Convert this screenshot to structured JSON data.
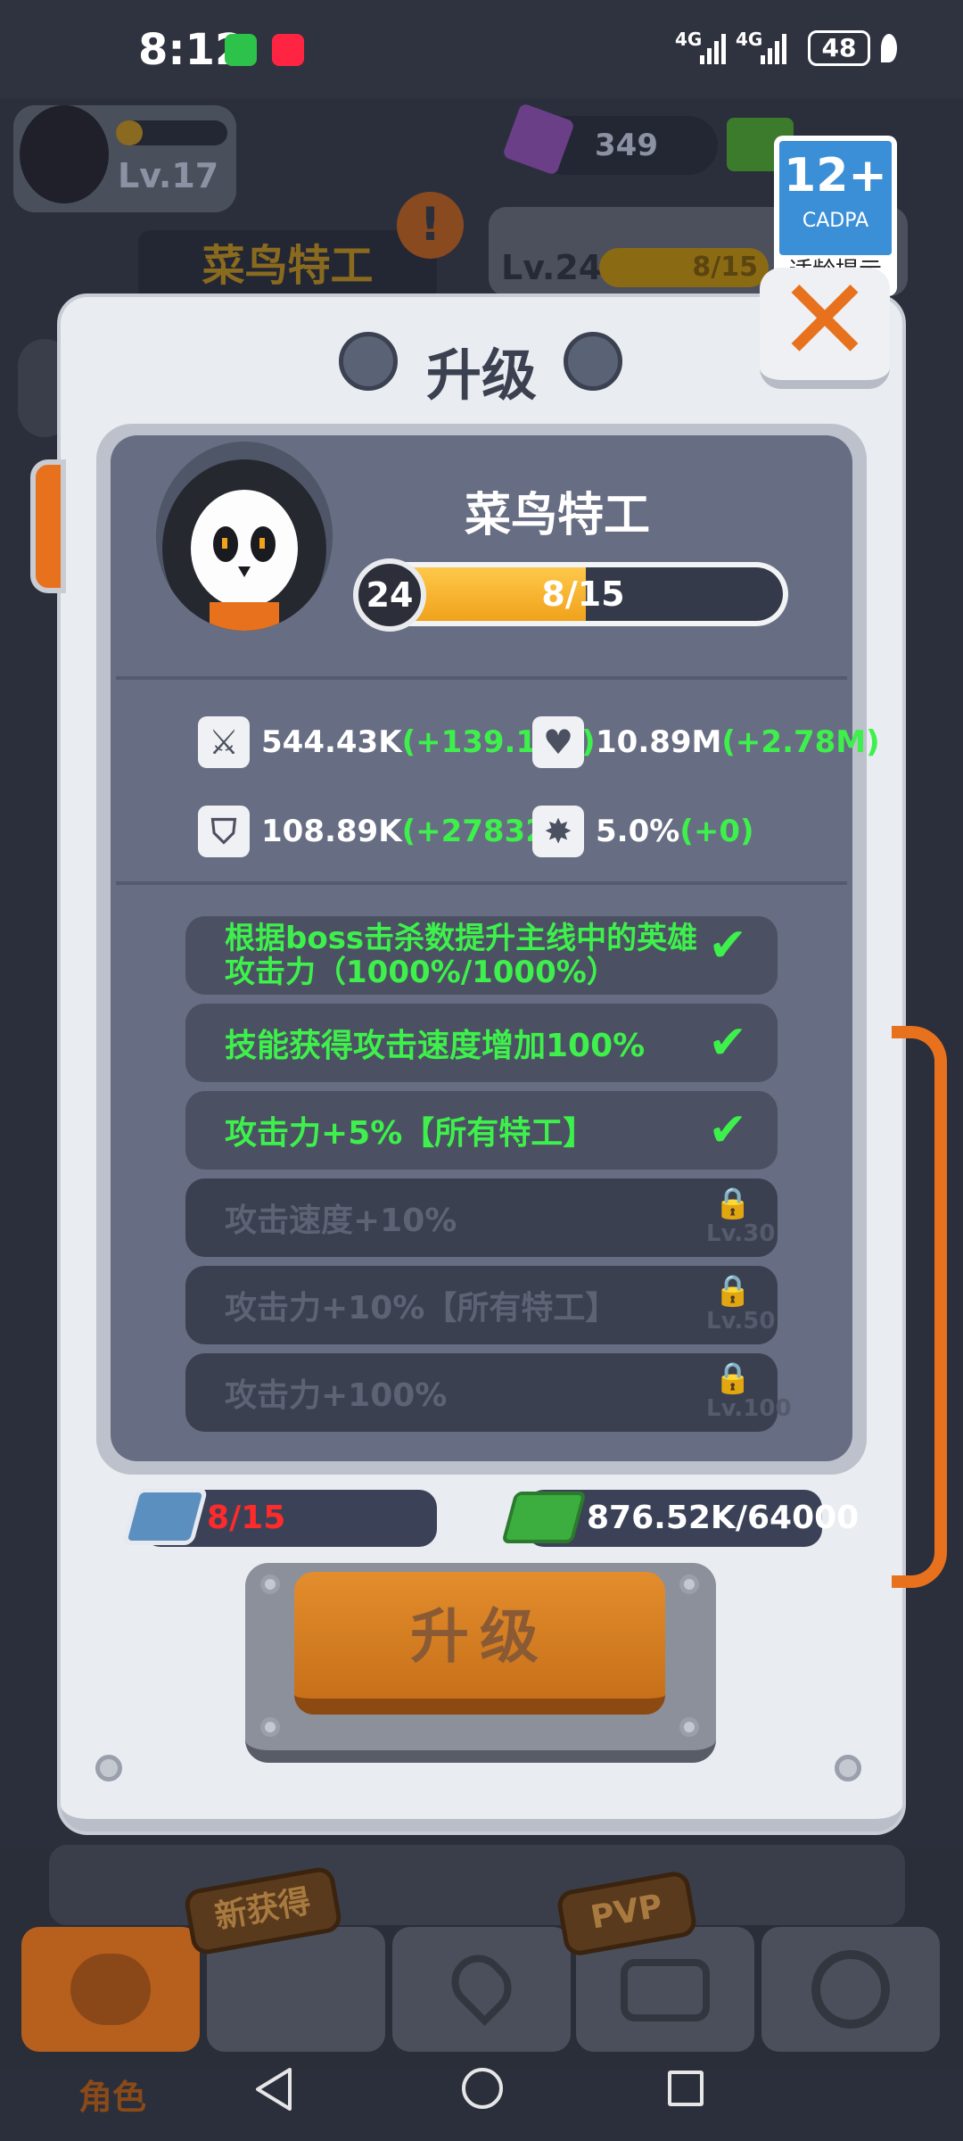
{
  "status_bar": {
    "time": "8:12",
    "net1": "4G",
    "net2": "4G",
    "battery": "48"
  },
  "top": {
    "player_level": "Lv.17",
    "gems": "349",
    "agent_name": "菜鸟特工",
    "agent_level": "Lv.24",
    "agent_progress": "8/15",
    "warning_icon": "exclamation-icon"
  },
  "cadpa": {
    "age": "12+",
    "org": "CADPA",
    "tip": "适龄提示"
  },
  "modal": {
    "title": "升级",
    "hero_name": "菜鸟特工",
    "level": "24",
    "progress_text": "8/15",
    "progress_fraction": 0.533,
    "stats": [
      {
        "icon": "sword-icon",
        "value": "544.43K",
        "bonus": "(+139.16K)"
      },
      {
        "icon": "heart-icon",
        "value": "10.89M",
        "bonus": "(+2.78M)"
      },
      {
        "icon": "shield-icon",
        "value": "108.89K",
        "bonus": "(+27832)"
      },
      {
        "icon": "crit-icon",
        "value": "5.0%",
        "bonus": "(+0)"
      }
    ],
    "perks": [
      {
        "text": "根据boss击杀数提升主线中的英雄攻击力（1000%/1000%）",
        "unlocked": true,
        "lock_level": ""
      },
      {
        "text": "技能获得攻击速度增加100%",
        "unlocked": true,
        "lock_level": ""
      },
      {
        "text": "攻击力+5%【所有特工】",
        "unlocked": true,
        "lock_level": ""
      },
      {
        "text": "攻击速度+10%",
        "unlocked": false,
        "lock_level": "Lv.30"
      },
      {
        "text": "攻击力+10%【所有特工】",
        "unlocked": false,
        "lock_level": "Lv.50"
      },
      {
        "text": "攻击力+100%",
        "unlocked": false,
        "lock_level": "Lv.100"
      }
    ],
    "cards": "8/15",
    "cash": "876.52K/64000",
    "upgrade_label": "升级"
  },
  "tabs": {
    "new_badge": "新获得",
    "pvp_badge": "PVP",
    "hero_label": "角色"
  },
  "colors": {
    "accent_orange": "#e8711d",
    "bonus_green": "#3ef04b",
    "progress_yellow": "#f0a21b",
    "cards_red": "#ff2a2a"
  }
}
